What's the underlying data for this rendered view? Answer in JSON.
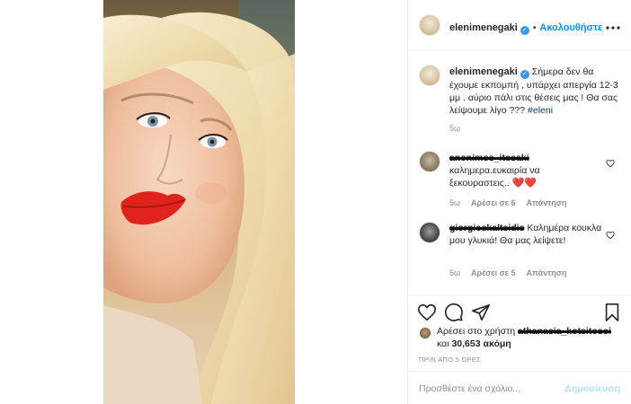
{
  "header": {
    "username": "elenimenegaki",
    "separator": "•",
    "follow_label": "Ακολουθήστε",
    "more_icon": "more-horizontal-icon"
  },
  "caption": {
    "username": "elenimenegaki",
    "text": "Σήμερα δεν θα έχουμε εκπομπή , υπάρχει απεργία 12-3 μμ . αύριο πάλι στις θέσεις μας ! Θα σας λείψουμε λίγο ???",
    "hashtag": "#eleni",
    "time": "5ω"
  },
  "comments": [
    {
      "username": "anonimos_itosaki",
      "text": "καλημερα.ευκαιρία να ξεκουραστεις..",
      "emoji": "❤️❤️",
      "time": "5ω",
      "likes": "Αρέσει σε 6",
      "reply": "Απάντηση"
    },
    {
      "username": "giorgioskaltsidis",
      "text": "Καλημέρα κουκλα μου γλυκιά! Θα μας λείψετε!",
      "time": "5ω",
      "likes": "Αρέσει σε 5",
      "reply": "Απάντηση"
    }
  ],
  "likes": {
    "prefix": "Αρέσει στο χρήστη",
    "user": "athanasia_kotsitosoi",
    "and": "και",
    "count": "30,653 ακόμη"
  },
  "posted": "ΠΡΙΝ ΑΠΟ 5 ΩΡΕΣ",
  "add_comment": {
    "placeholder": "Προσθέστε ένα σχόλιο...",
    "post_label": "Δημοσίευση"
  },
  "colors": {
    "accent": "#0095f6",
    "verified": "#3897f0",
    "post_disabled": "#b2dffc"
  }
}
